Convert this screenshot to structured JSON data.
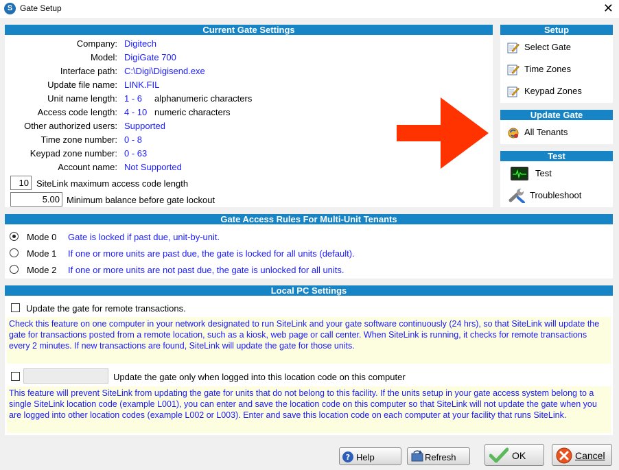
{
  "window": {
    "title": "Gate Setup",
    "close_symbol": "✕"
  },
  "current_settings": {
    "header": "Current Gate Settings",
    "rows": [
      {
        "label": "Company:",
        "value": "Digitech",
        "unit": ""
      },
      {
        "label": "Model:",
        "value": "DigiGate 700",
        "unit": ""
      },
      {
        "label": "Interface path:",
        "value": "C:\\Digi\\Digisend.exe",
        "unit": ""
      },
      {
        "label": "Update file name:",
        "value": "LINK.FIL",
        "unit": ""
      },
      {
        "label": "Unit name length:",
        "value": "1 - 6",
        "unit": "alphanumeric characters"
      },
      {
        "label": "Access code length:",
        "value": "4 - 10",
        "unit": "numeric characters"
      },
      {
        "label": "Other authorized users:",
        "value": "Supported",
        "unit": ""
      },
      {
        "label": "Time zone number:",
        "value": "0 - 8",
        "unit": ""
      },
      {
        "label": "Keypad zone number:",
        "value": "0 - 63",
        "unit": ""
      },
      {
        "label": "Account name:",
        "value": "Not Supported",
        "unit": ""
      }
    ],
    "max_code_length": {
      "value": "10",
      "label": "SiteLink maximum access code length"
    },
    "min_balance": {
      "value": "5.00",
      "label": "Minimum balance before gate lockout"
    }
  },
  "setup": {
    "header": "Setup",
    "items": [
      {
        "label": "Select Gate",
        "icon": "edit-icon"
      },
      {
        "label": "Time Zones",
        "icon": "edit-icon"
      },
      {
        "label": "Keypad Zones",
        "icon": "edit-icon"
      }
    ]
  },
  "update_gate": {
    "header": "Update Gate",
    "items": [
      {
        "label": "All Tenants",
        "icon": "sync-icon"
      }
    ]
  },
  "test": {
    "header": "Test",
    "items": [
      {
        "label": "Test",
        "icon": "monitor-icon"
      },
      {
        "label": "Troubleshoot",
        "icon": "wrench-icon"
      }
    ]
  },
  "access_rules": {
    "header": "Gate Access Rules For Multi-Unit Tenants",
    "modes": [
      {
        "label": "Mode 0",
        "desc": "Gate is locked if past due, unit-by-unit.",
        "selected": true
      },
      {
        "label": "Mode 1",
        "desc": "If one or more units are past due, the gate is locked for all units (default).",
        "selected": false
      },
      {
        "label": "Mode 2",
        "desc": "If one or more units are not past due, the gate is unlocked for all units.",
        "selected": false
      }
    ]
  },
  "local_pc": {
    "header": "Local PC Settings",
    "remote": {
      "label": "Update the gate for remote transactions.",
      "checked": false,
      "note": "Check this feature on one computer in your network designated to run SiteLink and your gate software continuously (24 hrs), so that SiteLink will update the gate for transactions posted from a remote location, such as a kiosk, web page or call center.  When SiteLink is running, it checks for remote transactions every 2 minutes.  If new transactions are found, SiteLink will update the gate for those units."
    },
    "location": {
      "label": "Update the gate only when logged into this location code on this computer",
      "checked": false,
      "code_value": "",
      "note": "This feature will prevent SiteLink from updating the gate for units that do not belong to this facility.  If the units setup in your gate access system belong to a single SiteLink location code (example L001), you can enter and save the location code on this computer so that SiteLink will not update the gate when you are logged into other location codes (example L002 or L003).  Enter and save this location code on each computer at your facility that runs SiteLink."
    }
  },
  "buttons": {
    "help": "Help",
    "refresh": "Refresh",
    "ok": "OK",
    "cancel": "Cancel"
  },
  "colors": {
    "header_bg": "#1784c5",
    "value_text": "#1a1aff",
    "note_bg": "#fdfde0",
    "arrow": "#ff3300"
  }
}
